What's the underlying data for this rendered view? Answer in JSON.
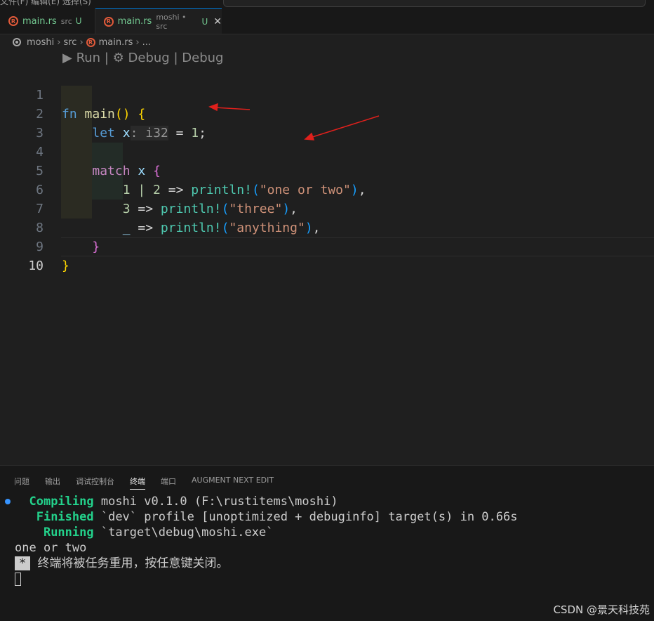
{
  "menubar": {
    "text": "文件(F) 编辑(E) 选择(S)"
  },
  "tabs": [
    {
      "name": "main.rs",
      "desc": "src",
      "badge": "U"
    },
    {
      "name": "main.rs",
      "desc": "moshi • src",
      "badge": "U",
      "close": "✕"
    }
  ],
  "breadcrumb": {
    "items": [
      "moshi",
      "src",
      "main.rs",
      "..."
    ]
  },
  "codelens": {
    "run": "Run",
    "debug1": "Debug",
    "debug2": "Debug",
    "separator": "|"
  },
  "editor": {
    "line_numbers": [
      "1",
      "2",
      "3",
      "4",
      "5",
      "6",
      "7",
      "8",
      "9",
      "10"
    ],
    "active_line": "10",
    "tokens": {
      "fn": "fn",
      "main": "main",
      "lp": "(",
      "rp": ")",
      "lb": "{",
      "rb": "}",
      "let": "let",
      "x": "x",
      "type_hint": ": i32",
      "eq": " = ",
      "one": "1",
      "semi": ";",
      "match": "match",
      "match_x": "x",
      "pat1": "1 | 2",
      "pat2": "3",
      "pat3": "_",
      "arrow": " => ",
      "println": "println!",
      "s1": "\"one or two\"",
      "s2": "\"three\"",
      "s3": "\"anything\"",
      "comma": ","
    }
  },
  "panel": {
    "tabs": [
      "问题",
      "输出",
      "调试控制台",
      "终端",
      "端口",
      "AUGMENT NEXT EDIT"
    ],
    "active_tab": "终端"
  },
  "terminal": {
    "compiling_label": "Compiling",
    "compiling_text": " moshi v0.1.0 (F:\\rustitems\\moshi)",
    "finished_label": "Finished",
    "finished_text": " `dev` profile [unoptimized + debuginfo] target(s) in 0.66s",
    "running_label": "Running",
    "running_text": " `target\\debug\\moshi.exe`",
    "output": "one or two",
    "star": "*",
    "reuse_message": "终端将被任务重用，按任意键关闭。"
  },
  "watermark": "CSDN @景天科技苑",
  "colors": {
    "accent": "#0078d4",
    "annotation_arrow": "#e0201c",
    "success": "#23d18b"
  }
}
